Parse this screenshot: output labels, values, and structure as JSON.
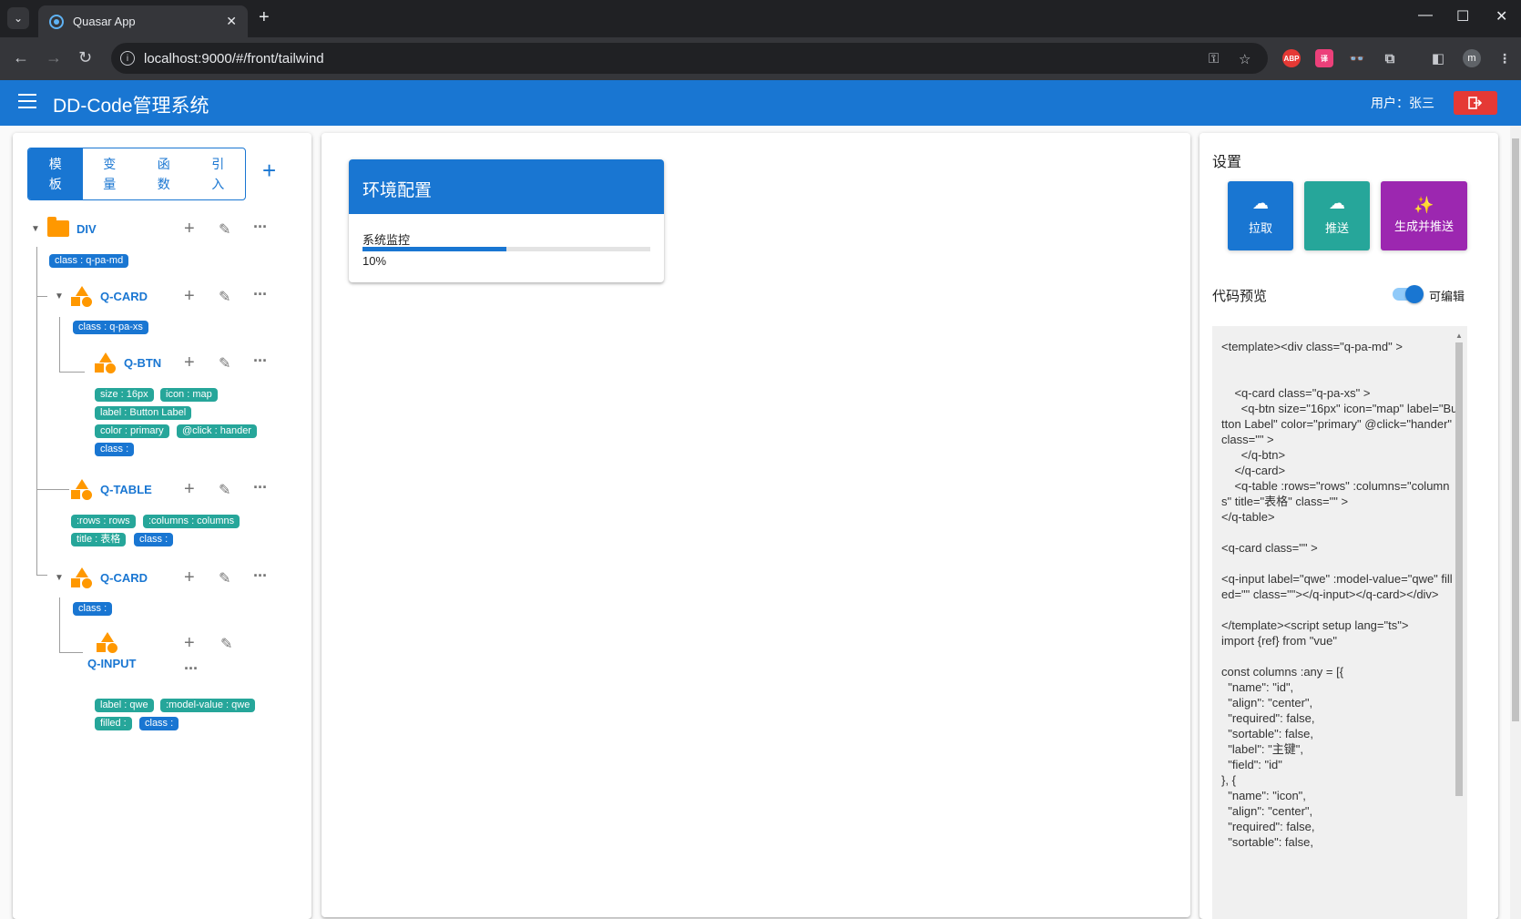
{
  "browser": {
    "tab_title": "Quasar App",
    "url": "localhost:9000/#/front/tailwind",
    "extensions": [
      "ABP",
      "translate",
      "eyes",
      "puzzle"
    ],
    "profile_initial": "m"
  },
  "header": {
    "title": "DD-Code管理系统",
    "user_label": "用户：张三"
  },
  "left": {
    "tabs": [
      {
        "label": "模板",
        "active": true
      },
      {
        "label": "变量",
        "active": false
      },
      {
        "label": "函数",
        "active": false
      },
      {
        "label": "引入",
        "active": false
      }
    ],
    "nodes": [
      {
        "label": "DIV",
        "chips": [
          {
            "text": "class : q-pa-md",
            "color": "blue"
          }
        ]
      },
      {
        "label": "Q-CARD",
        "chips": [
          {
            "text": "class : q-pa-xs",
            "color": "blue"
          }
        ]
      },
      {
        "label": "Q-BTN",
        "chips": [
          {
            "text": "size : 16px",
            "color": "teal"
          },
          {
            "text": "icon : map",
            "color": "teal"
          },
          {
            "text": "label : Button Label",
            "color": "teal"
          },
          {
            "text": "color : primary",
            "color": "teal"
          },
          {
            "text": "@click : hander",
            "color": "teal"
          },
          {
            "text": "class :",
            "color": "blue"
          }
        ]
      },
      {
        "label": "Q-TABLE",
        "chips": [
          {
            "text": ":rows : rows",
            "color": "teal"
          },
          {
            "text": ":columns : columns",
            "color": "teal"
          },
          {
            "text": "title : 表格",
            "color": "teal"
          },
          {
            "text": "class :",
            "color": "blue"
          }
        ]
      },
      {
        "label": "Q-CARD",
        "chips": [
          {
            "text": "class :",
            "color": "blue"
          }
        ]
      },
      {
        "label": "Q-INPUT",
        "chips": [
          {
            "text": "label : qwe",
            "color": "teal"
          },
          {
            "text": ":model-value : qwe",
            "color": "teal"
          },
          {
            "text": "filled :",
            "color": "teal"
          },
          {
            "text": "class :",
            "color": "blue"
          }
        ]
      }
    ]
  },
  "center": {
    "card_title": "环境配置",
    "card_subtitle": "系统监控",
    "progress_percent": "10%",
    "progress_value": 0.5
  },
  "right": {
    "settings_title": "设置",
    "buttons": [
      {
        "label": "拉取",
        "color": "#1976d2"
      },
      {
        "label": "推送",
        "color": "#26a69a"
      },
      {
        "label": "生成并推送",
        "color": "#9c27b0"
      }
    ],
    "preview_title": "代码预览",
    "editable_label": "可编辑",
    "code": "<template><div class=\"q-pa-md\" >\n\n\n    <q-card class=\"q-pa-xs\" >\n      <q-btn size=\"16px\" icon=\"map\" label=\"Button Label\" color=\"primary\" @click=\"hander\" class=\"\" >\n      </q-btn>\n    </q-card>\n    <q-table :rows=\"rows\" :columns=\"columns\" title=\"表格\" class=\"\" >\n</q-table>\n\n<q-card class=\"\" >\n\n<q-input label=\"qwe\" :model-value=\"qwe\" filled=\"\" class=\"\"></q-input></q-card></div>\n\n</template><script setup lang=\"ts\">\nimport {ref} from \"vue\"\n\nconst columns :any = [{\n  \"name\": \"id\",\n  \"align\": \"center\",\n  \"required\": false,\n  \"sortable\": false,\n  \"label\": \"主键\",\n  \"field\": \"id\"\n}, {\n  \"name\": \"icon\",\n  \"align\": \"center\",\n  \"required\": false,\n  \"sortable\": false,"
  }
}
